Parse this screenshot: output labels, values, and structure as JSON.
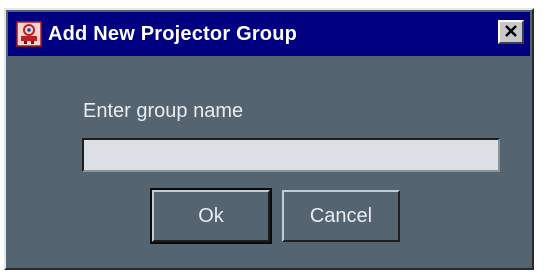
{
  "window": {
    "title": "Add New Projector Group",
    "app_icon": "projector-group-icon",
    "close_icon": "close-icon"
  },
  "form": {
    "prompt": "Enter group name",
    "group_name_value": "",
    "group_name_placeholder": ""
  },
  "buttons": {
    "ok_label": "Ok",
    "cancel_label": "Cancel"
  },
  "colors": {
    "titlebar": "#000080",
    "dialog_background": "#546470",
    "field_background": "#dde1e6",
    "text": "#e9edf0"
  }
}
